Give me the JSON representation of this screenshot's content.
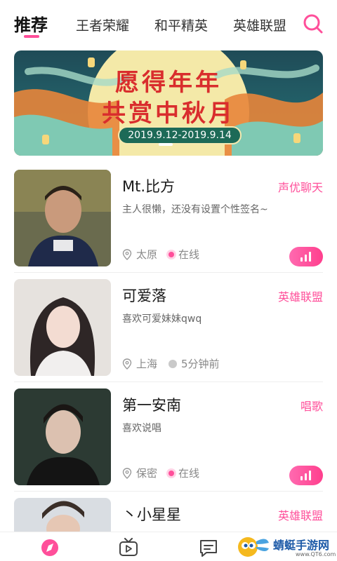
{
  "tabs": [
    {
      "label": "推荐",
      "active": true
    },
    {
      "label": "王者荣耀",
      "active": false
    },
    {
      "label": "和平精英",
      "active": false
    },
    {
      "label": "英雄联盟",
      "active": false
    }
  ],
  "search_icon": "search-icon",
  "banner": {
    "title_line1": "愿得年年",
    "title_line2": "共赏中秋月",
    "date": "2019.9.12-2019.9.14"
  },
  "users": [
    {
      "name": "Mt.比方",
      "tag": "声优聊天",
      "signature": "主人很懒，还没有设置个性签名~",
      "location": "太原",
      "status": "在线",
      "online": true,
      "has_voice": true
    },
    {
      "name": "可爱落",
      "tag": "英雄联盟",
      "signature": "喜欢可爱妹妹qwq",
      "location": "上海",
      "status": "5分钟前",
      "online": false,
      "has_voice": false
    },
    {
      "name": "第一安南",
      "tag": "唱歌",
      "signature": "喜欢说唱",
      "location": "保密",
      "status": "在线",
      "online": true,
      "has_voice": true
    },
    {
      "name": "丶小星星",
      "tag": "英雄联盟",
      "signature": "",
      "location": "",
      "status": "",
      "online": false,
      "has_voice": false
    }
  ],
  "bottom_nav": [
    {
      "icon": "discover-icon",
      "active": true
    },
    {
      "icon": "tv-icon",
      "active": false
    },
    {
      "icon": "message-icon",
      "active": false
    }
  ],
  "watermark": {
    "text": "蜻蜓手游网",
    "url": "www.QT6.com"
  },
  "colors": {
    "accent": "#ff4f9a",
    "banner_bg": "#236169",
    "title_red": "#d92d2d"
  }
}
